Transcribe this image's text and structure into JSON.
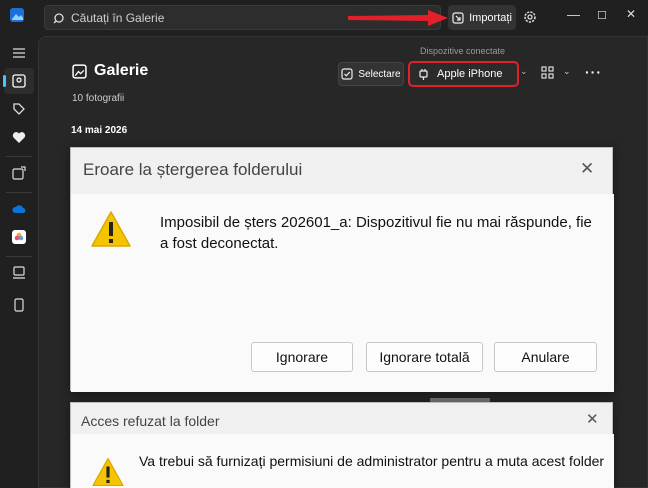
{
  "titlebar": {
    "search_placeholder": "Căutați în Galerie",
    "import_label": "Importați"
  },
  "window_controls": {
    "minimize": "—",
    "maximize": "☐",
    "close": "✕"
  },
  "gallery": {
    "title": "Galerie",
    "photo_count": "10 fotografii",
    "date_header": "14 mai 2026"
  },
  "toolbar": {
    "select_label": "Selectare",
    "devices_label": "Dispozitive conectate",
    "device_name": "Apple iPhone"
  },
  "dialog_error": {
    "title": "Eroare la ștergerea folderului",
    "message": "Imposibil de șters 202601_a: Dispozitivul fie nu mai răspunde, fie a fost deconectat.",
    "buttons": {
      "ignore": "Ignorare",
      "ignore_all": "Ignorare totală",
      "cancel": "Anulare"
    }
  },
  "dialog_access": {
    "title": "Acces refuzat la folder",
    "message": "Va trebui să furnizați permisiuni de administrator pentru a muta acest folder"
  },
  "colors": {
    "accent": "#4cc2ff",
    "highlight_red": "#e2202a",
    "warning_yellow": "#f5c400"
  },
  "icons": [
    "app-icon",
    "search-icon",
    "import-icon",
    "gear-icon",
    "hamburger-icon",
    "gallery-icon",
    "tag-icon",
    "heart-icon",
    "edit-photo-icon",
    "onedrive-icon",
    "icloud-photos-icon",
    "computer-icon",
    "phone-icon",
    "warning-icon"
  ]
}
